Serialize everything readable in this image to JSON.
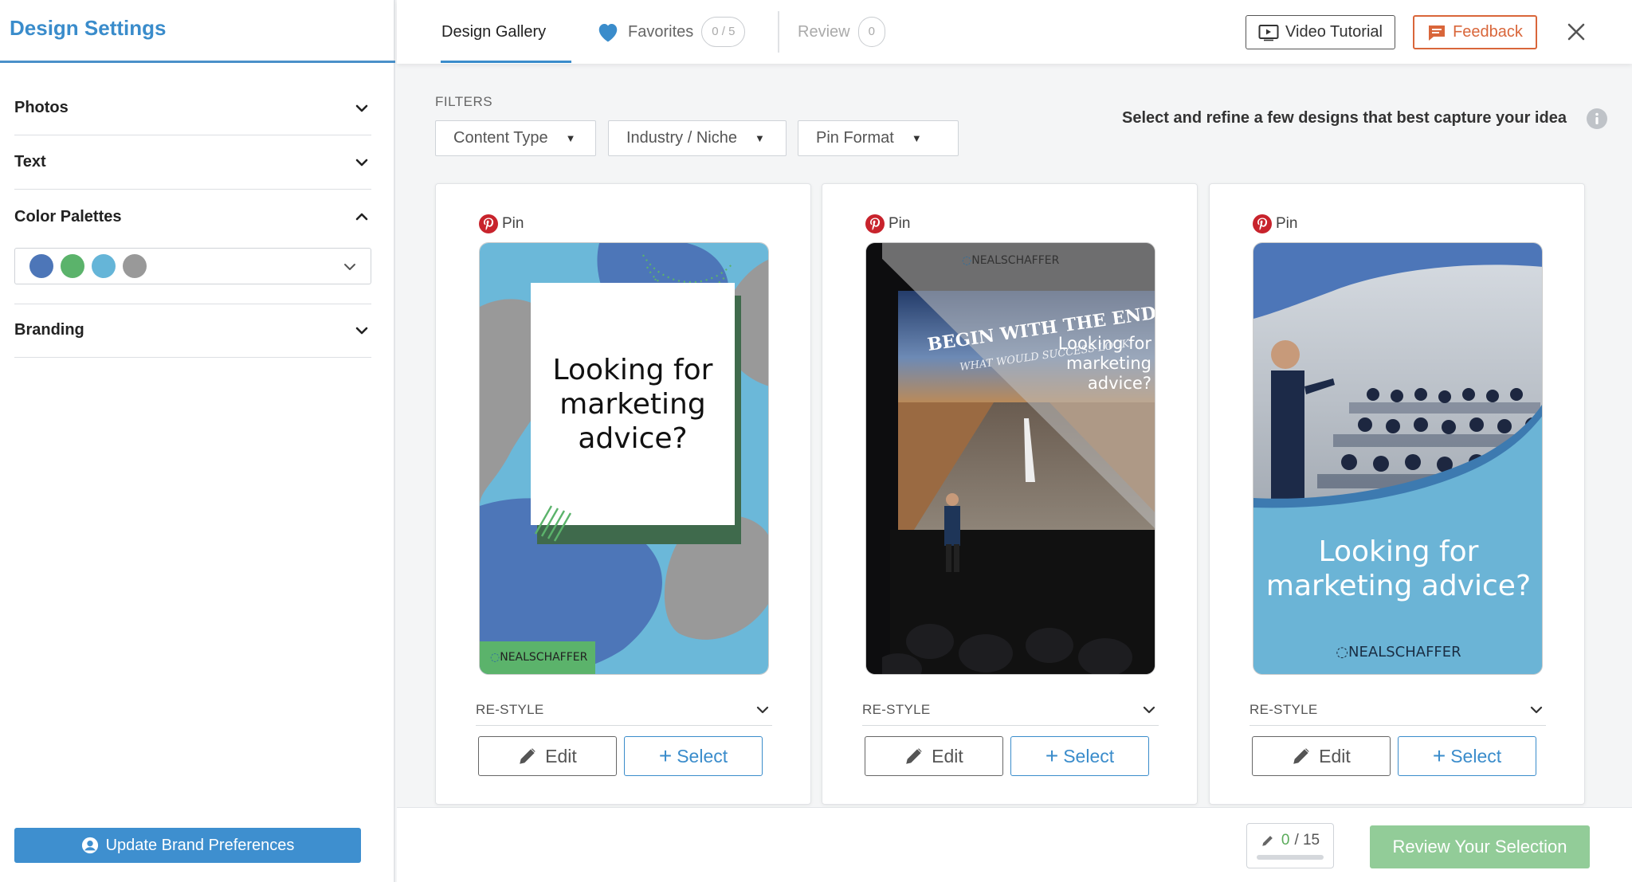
{
  "sidebar": {
    "title": "Design Settings",
    "sections": [
      {
        "label": "Photos",
        "state": "collapsed"
      },
      {
        "label": "Text",
        "state": "collapsed"
      },
      {
        "label": "Color Palettes",
        "state": "expanded"
      },
      {
        "label": "Branding",
        "state": "collapsed"
      }
    ],
    "palette_colors": [
      "#4d76b8",
      "#5bb36b",
      "#65b5d8",
      "#999999"
    ],
    "brand_button_label": "Update Brand Preferences"
  },
  "header": {
    "tabs": {
      "gallery": "Design Gallery",
      "favorites": "Favorites",
      "favorites_count": "0 / 5",
      "review": "Review",
      "review_count": "0"
    },
    "video_button": "Video Tutorial",
    "feedback_button": "Feedback"
  },
  "filters": {
    "label": "FILTERS",
    "items": [
      "Content Type",
      "Industry / Niche",
      "Pin Format"
    ],
    "hint": "Select and refine a few designs that best capture your idea"
  },
  "cards": [
    {
      "pin_label": "Pin",
      "headline": [
        "Looking for",
        "marketing",
        "advice?"
      ],
      "brand": "NEALSCHAFFER",
      "restyle_label": "RE-STYLE",
      "edit_label": "Edit",
      "select_label": "Select"
    },
    {
      "pin_label": "Pin",
      "headline": [
        "Looking for",
        "marketing",
        "advice?"
      ],
      "brand": "NEALSCHAFFER",
      "backdrop_line1": "BEGIN WITH THE END IN M",
      "backdrop_line2": "WHAT WOULD SUCCESS LOOK",
      "restyle_label": "RE-STYLE",
      "edit_label": "Edit",
      "select_label": "Select"
    },
    {
      "pin_label": "Pin",
      "headline": [
        "Looking for",
        "marketing advice?"
      ],
      "brand": "NEALSCHAFFER",
      "restyle_label": "RE-STYLE",
      "edit_label": "Edit",
      "select_label": "Select"
    }
  ],
  "footer": {
    "count_value": "0",
    "count_total": "/ 15",
    "review_button": "Review Your Selection"
  },
  "colors": {
    "accent_blue": "#3a8ccb",
    "feedback_orange": "#d9663a",
    "review_green": "#92cc98",
    "pinterest_red": "#c8232c"
  }
}
